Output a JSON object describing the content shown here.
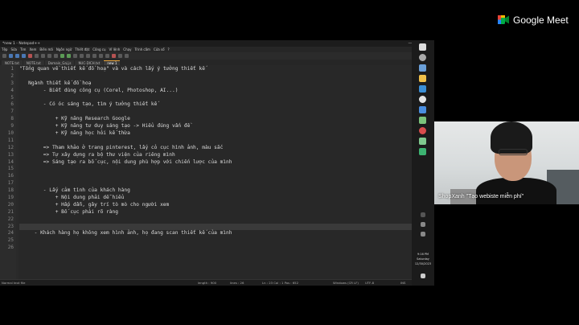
{
  "notepad": {
    "window_title": "*new 1 - Notepad++",
    "window_controls": [
      "—",
      "☐",
      "✕"
    ],
    "menu": [
      "Tệp",
      "Sửa",
      "Tìm",
      "Xem",
      "Biên mã",
      "Ngôn ngữ",
      "Thiết đặt",
      "Công cụ",
      "Vĩ lệnh",
      "Chạy",
      "Trình cắm",
      "Cửa sổ",
      "?"
    ],
    "tabs": [
      {
        "label": "NOTE.txt",
        "active": false
      },
      {
        "label": "NOTE.txt",
        "active": false
      },
      {
        "label": "Domain_Gaj.js",
        "active": false
      },
      {
        "label": "NUC-DICH.txt",
        "active": false
      },
      {
        "label": "new 1",
        "active": true
      }
    ],
    "lines": [
      "\"Tổng quan về thiết kế đồ hoạ\" và và cách lấy ý tưởng thiết kế",
      "",
      "   Ngành thiết kế đồ hoạ",
      "        - Biết dùng công cụ (Corel, Photoshop, AI...)",
      "",
      "        - Có óc sáng tạo, tìm ý tưởng thiết kế",
      "",
      "            + Kỹ năng Research Google",
      "            + Kỹ năng tư duy sáng tạo -> Hiểu đúng vấn đề",
      "            + Kỹ năng học hỏi kế thừa",
      "",
      "        => Tham khảo ở trang pinterest, lấy cỏ cục hình ảnh, màu sắc",
      "        => Tự xây dựng ra bộ thư viện của riêng mình",
      "        => Sáng tạo ra bố cục, nội dung phù hợp với chiến lược của mình",
      "",
      "",
      "",
      "        - Lấy cảm tình của khách hàng",
      "            + Nội dung phải dễ hiểu",
      "            + Hấp dẫn, gây trí tò mò cho người xem",
      "            + Bố cục phải rõ ràng",
      "",
      "",
      "     - Khách hàng họ không xem hình ảnh, họ đang scan thiết kế của mình",
      "",
      ""
    ],
    "current_line_index": 22,
    "status": {
      "file_type": "Normal text file",
      "length": "length : 900",
      "lines": "lines : 26",
      "position": "Ln : 23    Col : 1    Pos : 652",
      "eol": "Windows (CR LF)",
      "encoding": "UTF-8",
      "mode": "INS"
    }
  },
  "taskbar": {
    "time": "9:16 PM",
    "day": "Saturday",
    "date": "12/30/2023"
  },
  "meet": {
    "title": "Google Meet",
    "participant_name": "ShopXanh \"Tạo webiste miễn phí\"",
    "colors": {
      "green": "#00ac47",
      "blue": "#2684fc",
      "yellow": "#ffba00",
      "red": "#ea4335"
    }
  }
}
